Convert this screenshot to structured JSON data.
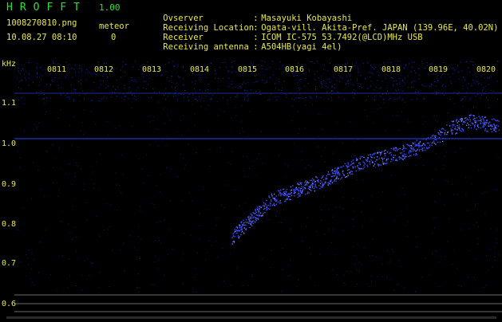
{
  "app": {
    "title": "HROFFT",
    "version": "1.00"
  },
  "file": {
    "name": "1008270810.png",
    "datetime": "10.08.27 08:10"
  },
  "counter": {
    "label": "meteor",
    "value": "0"
  },
  "meta": [
    {
      "key": "Ovserver",
      "sep": ":",
      "value": "Masayuki Kobayashi"
    },
    {
      "key": "Receiving Location",
      "sep": ":",
      "value": "Ogata-vill. Akita-Pref. JAPAN (139.96E, 40.02N)"
    },
    {
      "key": "Receiver",
      "sep": ":",
      "value": "ICOM IC-575 53.7492(@LCD)MHz USB"
    },
    {
      "key": "Receiving antenna",
      "sep": ":",
      "value": "A504HB(yagi 4el)"
    }
  ],
  "spectrogram": {
    "yunit": "kHz",
    "time_ticks": [
      "0811",
      "0812",
      "0813",
      "0814",
      "0815",
      "0816",
      "0817",
      "0818",
      "0819",
      "0820"
    ],
    "freq_ticks": [
      "1.1",
      "1.0",
      "0.9",
      "0.8",
      "0.7",
      "0.6"
    ],
    "colors": {
      "tick_label": "#e8e84a",
      "signal": "#3a4cff",
      "noise": "#1a25b0"
    }
  }
}
